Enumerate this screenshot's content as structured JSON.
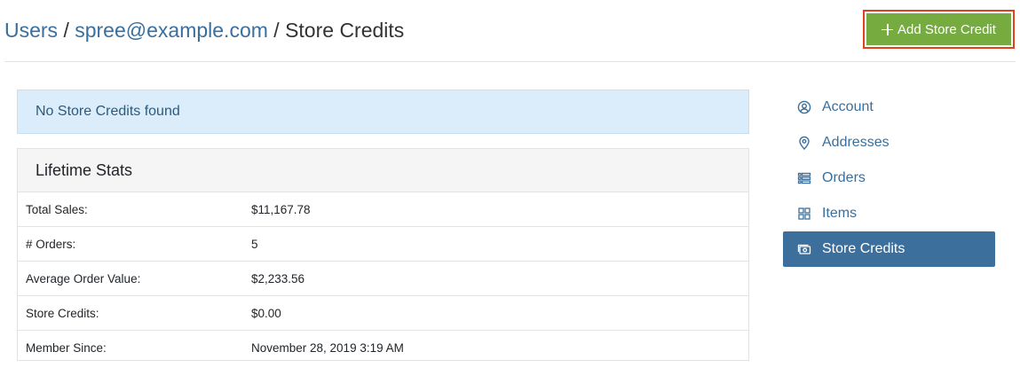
{
  "breadcrumb": {
    "users": "Users",
    "separator": "/",
    "user_email": "spree@example.com",
    "current": "Store Credits"
  },
  "actions": {
    "add_store_credit": "Add Store Credit"
  },
  "alert": {
    "message": "No Store Credits found"
  },
  "lifetime_stats": {
    "title": "Lifetime Stats",
    "rows": [
      {
        "label": "Total Sales:",
        "value": "$11,167.78"
      },
      {
        "label": "# Orders:",
        "value": "5"
      },
      {
        "label": "Average Order Value:",
        "value": "$2,233.56"
      },
      {
        "label": "Store Credits:",
        "value": "$0.00"
      },
      {
        "label": "Member Since:",
        "value": "November 28, 2019 3:19 AM"
      }
    ]
  },
  "sidebar": {
    "items": [
      {
        "label": "Account",
        "icon": "user-circle-icon",
        "active": false
      },
      {
        "label": "Addresses",
        "icon": "map-pin-icon",
        "active": false
      },
      {
        "label": "Orders",
        "icon": "list-icon",
        "active": false
      },
      {
        "label": "Items",
        "icon": "grid-icon",
        "active": false
      },
      {
        "label": "Store Credits",
        "icon": "cash-icon",
        "active": true
      }
    ]
  },
  "colors": {
    "link": "#3a6f9d",
    "add_button": "#76ab3f",
    "add_button_highlight": "#e0421d",
    "alert_bg": "#dbedfa",
    "active_nav": "#3d6f9d"
  }
}
